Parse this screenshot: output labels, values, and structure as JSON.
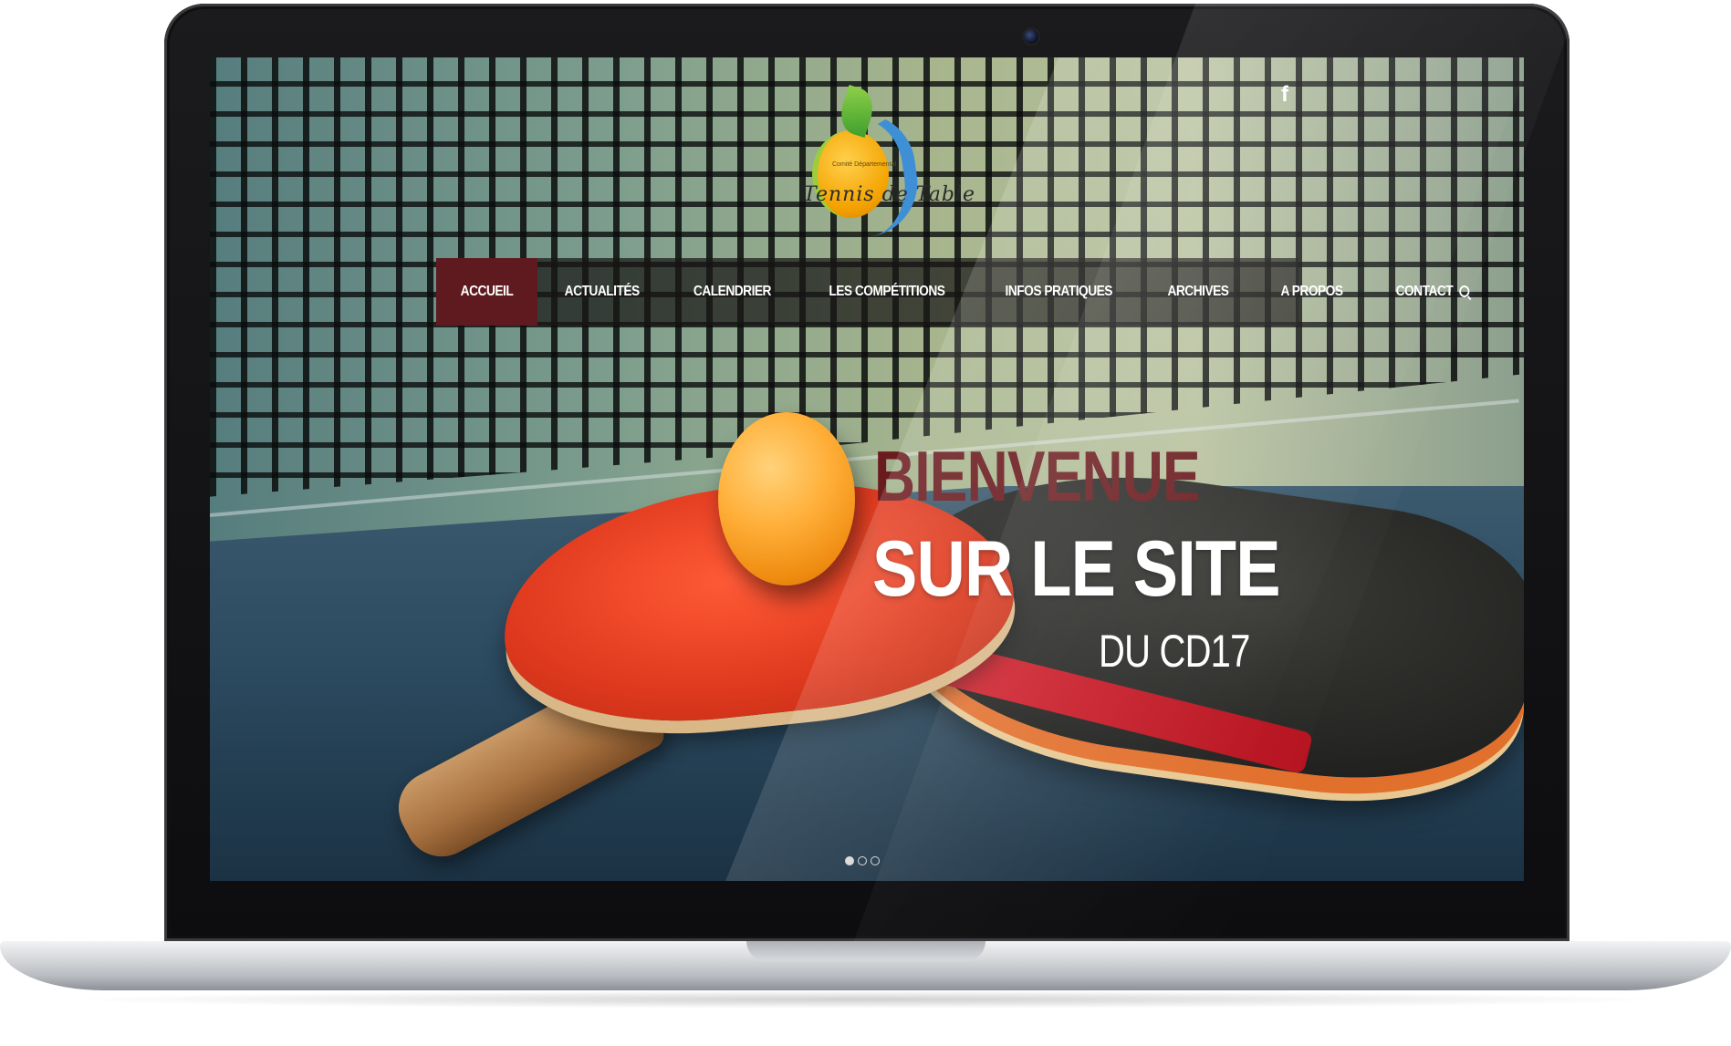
{
  "site": {
    "logo_text": "Tennis de Table",
    "logo_subtext": "Comité Départemental"
  },
  "social": {
    "facebook_icon": "facebook-icon",
    "facebook_glyph": "f"
  },
  "nav": {
    "items": [
      {
        "label": "ACCUEIL",
        "active": true
      },
      {
        "label": "ACTUALITÉS",
        "active": false
      },
      {
        "label": "CALENDRIER",
        "active": false
      },
      {
        "label": "LES COMPÉTITIONS",
        "active": false
      },
      {
        "label": "INFOS PRATIQUES",
        "active": false
      },
      {
        "label": "ARCHIVES",
        "active": false
      },
      {
        "label": "A PROPOS",
        "active": false
      },
      {
        "label": "CONTACT",
        "active": false
      }
    ],
    "search_icon": "search-icon"
  },
  "hero": {
    "line1": "BIENVENUE",
    "line2": "SUR LE SITE",
    "line3": "DU CD17"
  },
  "slider": {
    "total": 3,
    "active_index": 0
  },
  "colors": {
    "accent": "#5e1a1f",
    "hero_line1": "#6a1b1e",
    "nav_bg": "#191816"
  }
}
